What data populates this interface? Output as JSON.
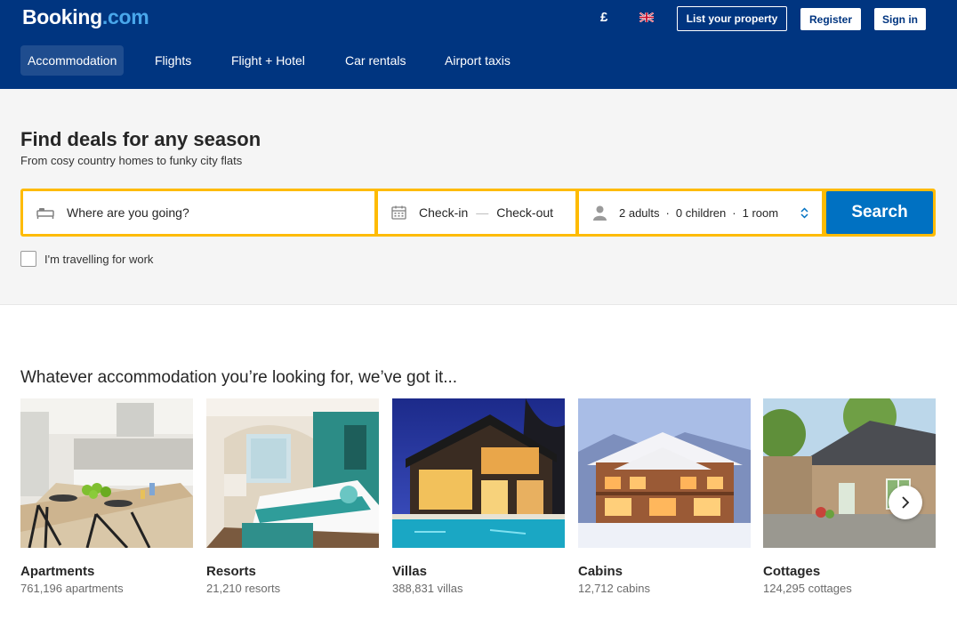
{
  "header": {
    "logo_main": "Booking",
    "logo_suffix": ".com",
    "currency": "£",
    "list_property": "List your property",
    "register": "Register",
    "sign_in": "Sign in",
    "nav": [
      "Accommodation",
      "Flights",
      "Flight + Hotel",
      "Car rentals",
      "Airport taxis"
    ]
  },
  "search": {
    "title": "Find deals for any season",
    "subtitle": "From cosy country homes to funky city flats",
    "destination_placeholder": "Where are you going?",
    "check_in": "Check-in",
    "dates_separator": "—",
    "check_out": "Check-out",
    "adults": "2 adults",
    "children": "0 children",
    "rooms": "1 room",
    "guest_separator": "·",
    "search_button": "Search",
    "work_travel": "I'm travelling for work"
  },
  "accommodation": {
    "title": "Whatever accommodation you’re looking for, we’ve got it...",
    "cards": [
      {
        "name": "Apartments",
        "count": "761,196 apartments"
      },
      {
        "name": "Resorts",
        "count": "21,210 resorts"
      },
      {
        "name": "Villas",
        "count": "388,831 villas"
      },
      {
        "name": "Cabins",
        "count": "12,712 cabins"
      },
      {
        "name": "Cottages",
        "count": "124,295 cottages"
      }
    ]
  },
  "colors": {
    "brand_blue": "#003580",
    "accent_yellow": "#febb02",
    "button_blue": "#0071c2"
  }
}
